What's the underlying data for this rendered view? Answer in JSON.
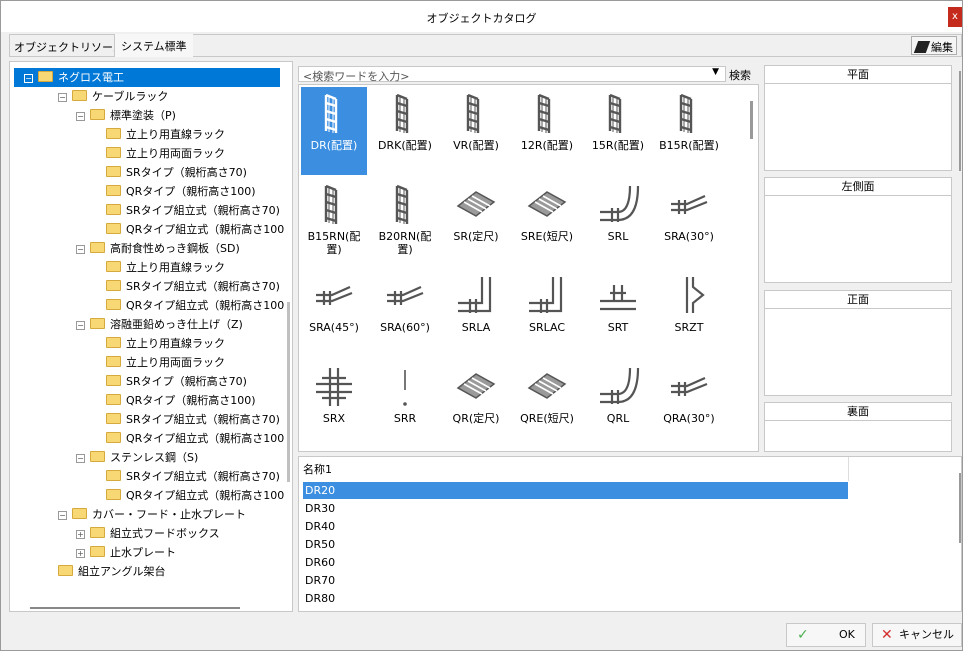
{
  "window": {
    "title": "オブジェクトカタログ",
    "close": "x"
  },
  "tabs": {
    "resource_label": "オブジェクトリソース",
    "active_tab": "システム標準",
    "edit": "編集"
  },
  "tree": [
    {
      "label": "ネグロス電工",
      "level": 0,
      "expander": "⊟",
      "selected": true
    },
    {
      "label": "ケーブルラック",
      "level": 1,
      "expander": "⊟"
    },
    {
      "label": "標準塗装（P)",
      "level": 2,
      "expander": "⊟"
    },
    {
      "label": "立上り用直線ラック",
      "level": 3
    },
    {
      "label": "立上り用両面ラック",
      "level": 3
    },
    {
      "label": "SRタイプ（親桁高さ70)",
      "level": 3
    },
    {
      "label": "QRタイプ（親桁高さ100)",
      "level": 3
    },
    {
      "label": "SRタイプ組立式（親桁高さ70)",
      "level": 3
    },
    {
      "label": "QRタイプ組立式（親桁高さ100",
      "level": 3
    },
    {
      "label": "高耐食性めっき鋼板（SD)",
      "level": 2,
      "expander": "⊟"
    },
    {
      "label": "立上り用直線ラック",
      "level": 3
    },
    {
      "label": "SRタイプ組立式（親桁高さ70)",
      "level": 3
    },
    {
      "label": "QRタイプ組立式（親桁高さ100",
      "level": 3
    },
    {
      "label": "溶融亜鉛めっき仕上げ（Z)",
      "level": 2,
      "expander": "⊟"
    },
    {
      "label": "立上り用直線ラック",
      "level": 3
    },
    {
      "label": "立上り用両面ラック",
      "level": 3
    },
    {
      "label": "SRタイプ（親桁高さ70)",
      "level": 3
    },
    {
      "label": "QRタイプ（親桁高さ100)",
      "level": 3
    },
    {
      "label": "SRタイプ組立式（親桁高さ70)",
      "level": 3
    },
    {
      "label": "QRタイプ組立式（親桁高さ100",
      "level": 3
    },
    {
      "label": "ステンレス鋼（S)",
      "level": 2,
      "expander": "⊟"
    },
    {
      "label": "SRタイプ組立式（親桁高さ70)",
      "level": 3
    },
    {
      "label": "QRタイプ組立式（親桁高さ100",
      "level": 3
    },
    {
      "label": "カバー・フード・止水プレート",
      "level": 1,
      "expander": "⊟"
    },
    {
      "label": "組立式フードボックス",
      "level": 2,
      "expander": "⊞"
    },
    {
      "label": "止水プレート",
      "level": 2,
      "expander": "⊞"
    },
    {
      "label": "組立アングル架台",
      "level": 1
    }
  ],
  "search": {
    "placeholder": "<検索ワードを入力>",
    "dropdown": "▼",
    "button": "検索"
  },
  "catalog": [
    {
      "label": "DR(配置)",
      "icon": "ladder",
      "selected": true
    },
    {
      "label": "DRK(配置)",
      "icon": "ladder"
    },
    {
      "label": "VR(配置)",
      "icon": "ladder"
    },
    {
      "label": "12R(配置)",
      "icon": "ladder"
    },
    {
      "label": "15R(配置)",
      "icon": "ladder"
    },
    {
      "label": "B15R(配置)",
      "icon": "ladder"
    },
    {
      "label": "B15RN(配置)",
      "icon": "ladder"
    },
    {
      "label": "B20RN(配置)",
      "icon": "ladder"
    },
    {
      "label": "SR(定尺)",
      "icon": "tray"
    },
    {
      "label": "SRE(短尺)",
      "icon": "tray"
    },
    {
      "label": "SRL",
      "icon": "elbow"
    },
    {
      "label": "SRA(30°)",
      "icon": "angle"
    },
    {
      "label": "SRA(45°)",
      "icon": "angle"
    },
    {
      "label": "SRA(60°)",
      "icon": "angle"
    },
    {
      "label": "SRLA",
      "icon": "riser"
    },
    {
      "label": "SRLAC",
      "icon": "riser"
    },
    {
      "label": "SRT",
      "icon": "tee"
    },
    {
      "label": "SRZT",
      "icon": "tee-side"
    },
    {
      "label": "SRX",
      "icon": "cross"
    },
    {
      "label": "SRR",
      "icon": "line"
    },
    {
      "label": "QR(定尺)",
      "icon": "tray"
    },
    {
      "label": "QRE(短尺)",
      "icon": "tray"
    },
    {
      "label": "QRL",
      "icon": "elbow"
    },
    {
      "label": "QRA(30°)",
      "icon": "angle"
    }
  ],
  "views": {
    "top": "平面",
    "left": "左側面",
    "front": "正面",
    "back": "裏面"
  },
  "list": {
    "header": "名称1",
    "rows": [
      "DR20",
      "DR30",
      "DR40",
      "DR50",
      "DR60",
      "DR70",
      "DR80"
    ],
    "selected": 0
  },
  "footer": {
    "ok": "OK",
    "ok_icon": "✓",
    "cancel": "キャンセル",
    "cancel_icon": "✕"
  }
}
